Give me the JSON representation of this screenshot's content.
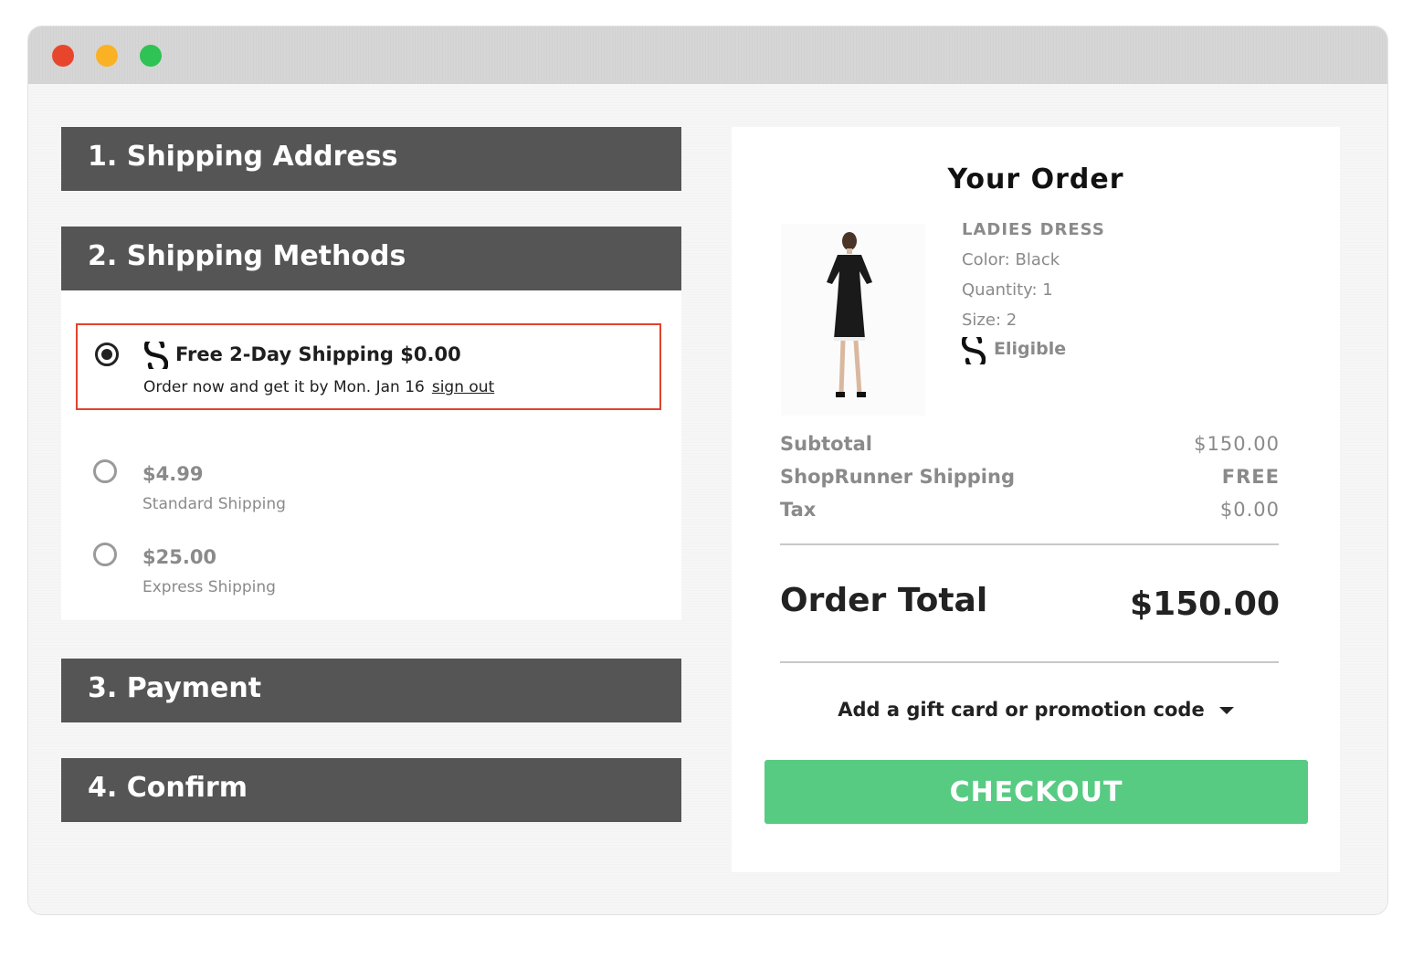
{
  "window": {
    "controls": [
      "close",
      "minimize",
      "maximize"
    ]
  },
  "steps": {
    "shipping_address": "1. Shipping Address",
    "shipping_methods": "2. Shipping Methods",
    "payment": "3. Payment",
    "confirm": "4. Confirm"
  },
  "shipping_options": {
    "selected": {
      "title": "Free 2-Day Shipping $0.00",
      "subtitle": "Order now and get it by Mon. Jan 16",
      "sign_out": "sign out"
    },
    "standard": {
      "price": "$4.99",
      "name": "Standard Shipping"
    },
    "express": {
      "price": "$25.00",
      "name": "Express Shipping"
    }
  },
  "order": {
    "title": "Your Order",
    "product": {
      "name": "LADIES DRESS",
      "color": "Color: Black",
      "quantity": "Quantity: 1",
      "size": "Size: 2",
      "eligible": "Eligible",
      "image": "black-dress-model"
    },
    "summary": {
      "subtotal_label": "Subtotal",
      "subtotal_value": "$150.00",
      "shipping_label": "ShopRunner Shipping",
      "shipping_value": "FREE",
      "tax_label": "Tax",
      "tax_value": "$0.00"
    },
    "total_label": "Order Total",
    "total_value": "$150.00",
    "promo": "Add a gift card or promotion code",
    "checkout": "CHECKOUT"
  },
  "colors": {
    "header_bg": "#555555",
    "highlight_border": "#e0442a",
    "checkout_bg": "#57cb82",
    "close": "#e8462c",
    "minimize": "#fbb124",
    "maximize": "#2fc254"
  }
}
